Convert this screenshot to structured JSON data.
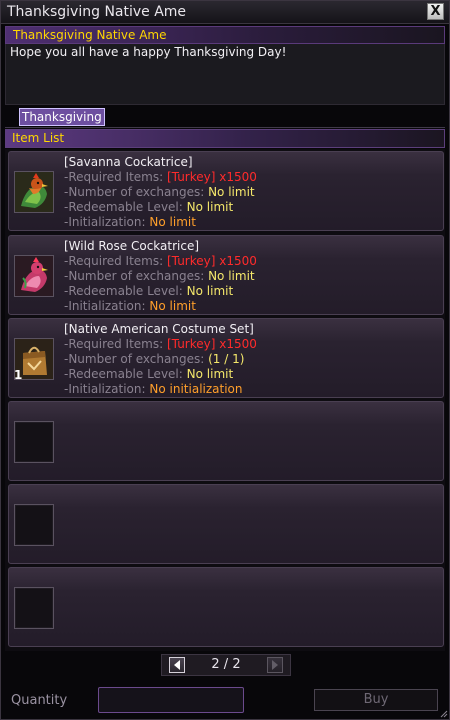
{
  "window": {
    "title": "Thanksgiving Native Ame",
    "close_label": "X"
  },
  "event": {
    "header": "Thanksgiving Native Ame",
    "description": "Hope you all have a happy Thanksgiving Day!"
  },
  "tabs": [
    {
      "label": "Thanksgiving",
      "active": true
    }
  ],
  "item_list": {
    "header": "Item List",
    "labels": {
      "required": "-Required Items:",
      "exchanges": "-Number of exchanges:",
      "level": "-Redeemable Level:",
      "init": "-Initialization:"
    },
    "items": [
      {
        "name": "[Savanna Cockatrice]",
        "icon": "savanna-cockatrice-icon",
        "required": "[Turkey] x1500",
        "exchanges": "No limit",
        "level": "No limit",
        "init": "No limit"
      },
      {
        "name": "[Wild Rose Cockatrice]",
        "icon": "wild-rose-cockatrice-icon",
        "required": "[Turkey] x1500",
        "exchanges": "No limit",
        "level": "No limit",
        "init": "No limit"
      },
      {
        "name": "[Native American Costume Set]",
        "icon": "costume-bag-icon",
        "quantity": "1",
        "required": "[Turkey] x1500",
        "exchanges": "(1 / 1)",
        "level": "No limit",
        "init": "No initialization"
      }
    ],
    "empty_slots": 3
  },
  "pagination": {
    "text": "2 / 2",
    "prev_icon": "arrow-left-icon",
    "next_icon": "arrow-right-icon"
  },
  "footer": {
    "quantity_label": "Quantity",
    "quantity_value": "",
    "buy_label": "Buy"
  },
  "colors": {
    "header_text": "#ffd700",
    "required_text": "#ff2b2b",
    "value_text": "#f5e86b",
    "init_text": "#ff9f2a",
    "accent": "#5d3a82"
  }
}
